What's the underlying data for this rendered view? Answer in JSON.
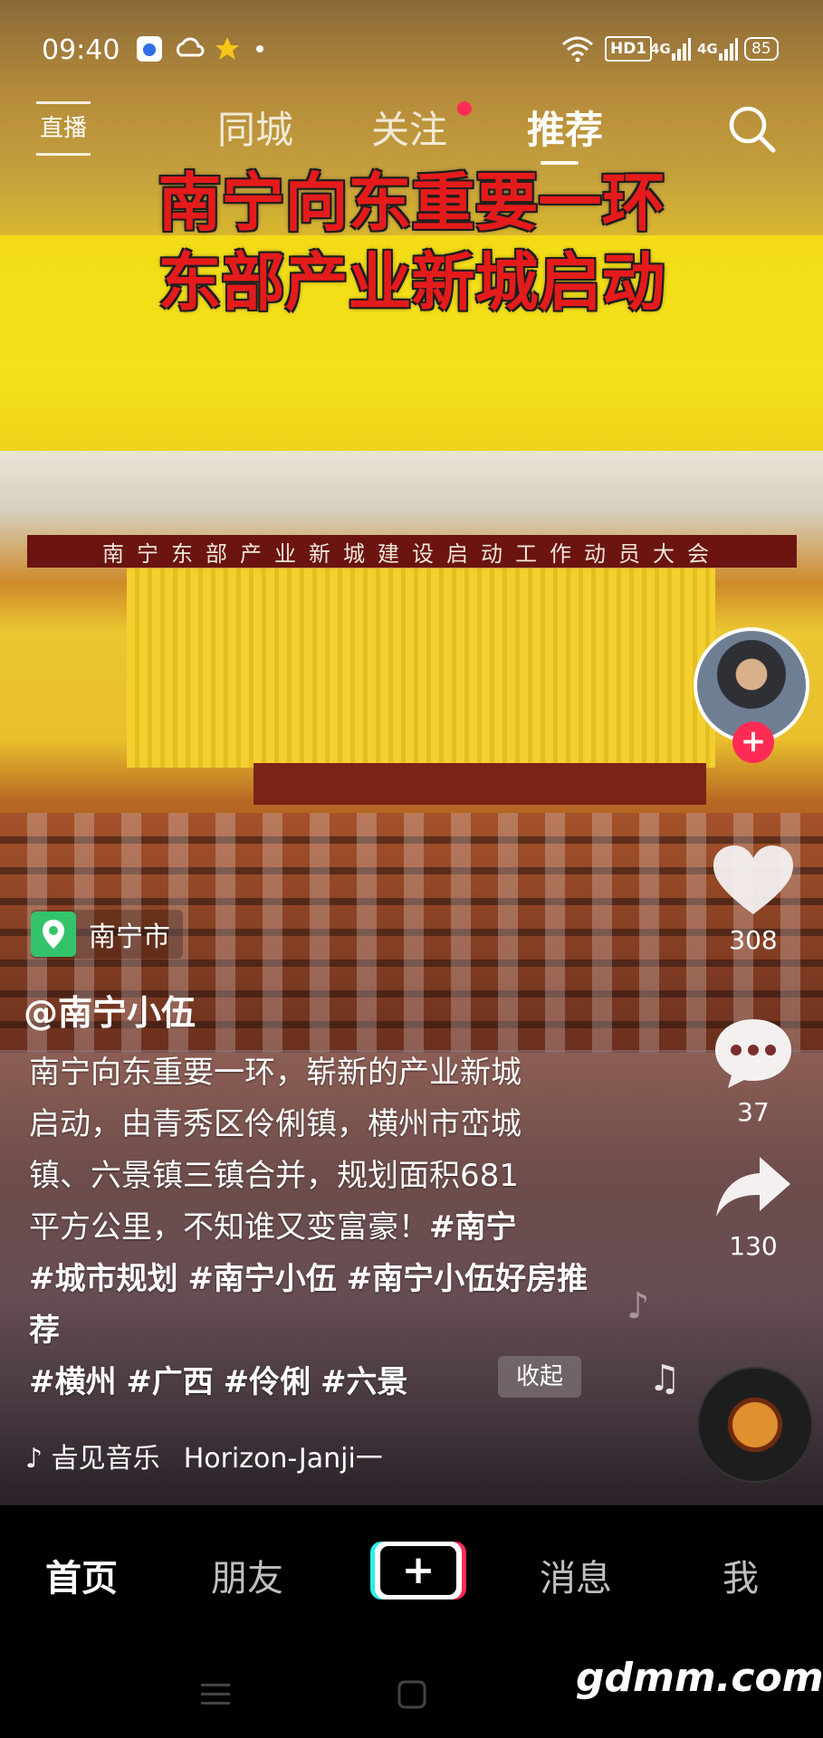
{
  "status_bar": {
    "time": "09:40",
    "network_badge": "HD1",
    "signal_1": "4G",
    "signal_2": "4G",
    "battery": "85"
  },
  "top_nav": {
    "live_label": "直播",
    "tabs": [
      {
        "label": "同城",
        "active": false
      },
      {
        "label": "关注",
        "active": false,
        "has_dot": true
      },
      {
        "label": "推荐",
        "active": true
      }
    ]
  },
  "video": {
    "headline_line1": "南宁向东重要一环",
    "headline_line2": "东部产业新城启动",
    "banner_text": "南宁东部产业新城建设启动工作动员大会"
  },
  "post": {
    "location": "南宁市",
    "author": "@南宁小伍",
    "description_line1": "南宁向东重要一环，崭新的产业新城",
    "description_line2": "启动，由青秀区伶俐镇，横州市峦城",
    "description_line3": "镇、六景镇三镇合并，规划面积681",
    "description_line4": "平方公里，不知谁又变富豪！",
    "hashtags": [
      "#南宁",
      "#城市规划",
      "#南宁小伍",
      "#南宁小伍好房推荐",
      "#横州",
      "#广西",
      "#伶俐",
      "#六景"
    ],
    "collapse_label": "收起",
    "music_prefix": "♪ 㫖见音乐",
    "music_title": "Horizon-Janji一"
  },
  "actions": {
    "like_count": "308",
    "comment_count": "37",
    "share_count": "130"
  },
  "bottom_nav": {
    "items": [
      {
        "label": "首页",
        "active": true
      },
      {
        "label": "朋友",
        "active": false
      },
      {
        "label": "+",
        "active": false
      },
      {
        "label": "消息",
        "active": false
      },
      {
        "label": "我",
        "active": false
      }
    ]
  },
  "watermark": "gdmm.com",
  "colors": {
    "accent_red": "#fe2c55",
    "accent_cyan": "#2af0ea",
    "location_green": "#33c36b",
    "headline_red": "#e51b1b"
  }
}
